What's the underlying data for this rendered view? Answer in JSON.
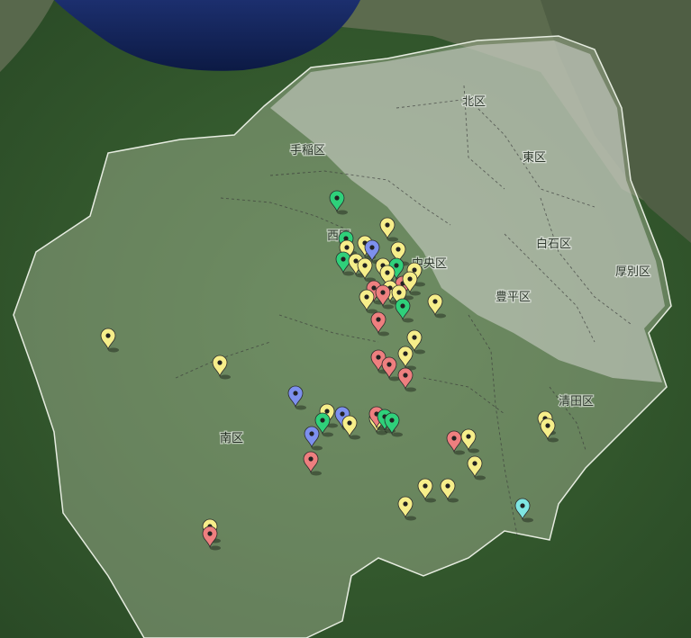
{
  "map": {
    "wards": [
      {
        "id": "kita",
        "label": "北区"
      },
      {
        "id": "higashi",
        "label": "東区"
      },
      {
        "id": "teine",
        "label": "手稲区"
      },
      {
        "id": "nishi",
        "label": "西区"
      },
      {
        "id": "chuo",
        "label": "中央区"
      },
      {
        "id": "shiroishi",
        "label": "白石区"
      },
      {
        "id": "atsubetsu",
        "label": "厚別区"
      },
      {
        "id": "toyohira",
        "label": "豊平区"
      },
      {
        "id": "kiyota",
        "label": "清田区"
      },
      {
        "id": "minami",
        "label": "南区"
      }
    ],
    "marker_colors": {
      "yellow": "#f6ee8a",
      "green": "#2fd07a",
      "red": "#ee7f7f",
      "blue": "#7d90ee",
      "cyan": "#7fe6e2"
    },
    "marker_icon": "map-pin-icon"
  }
}
